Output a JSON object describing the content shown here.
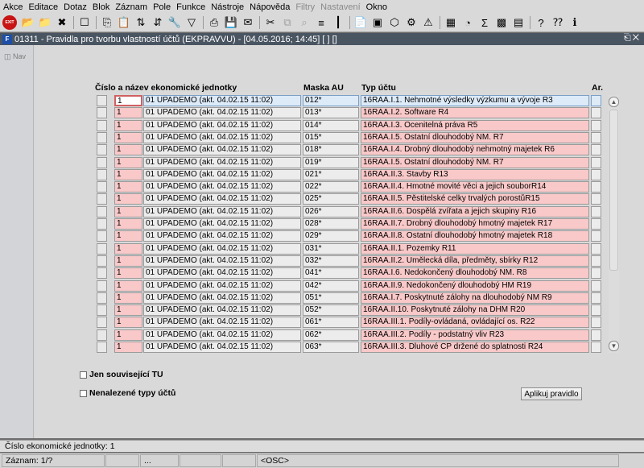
{
  "menu": [
    "Akce",
    "Editace",
    "Dotaz",
    "Blok",
    "Záznam",
    "Pole",
    "Funkce",
    "Nástroje",
    "Nápověda",
    "Filtry",
    "Nastavení",
    "Okno"
  ],
  "menu_disabled": [
    "Filtry",
    "Nastavení"
  ],
  "toolbar": {
    "exit_label": "EXIT",
    "icons": [
      "folder-add-icon",
      "folder-icon",
      "folder-delete-icon",
      "clear-icon",
      "copy-icon",
      "paste-icon",
      "sort-asc-icon",
      "sort-desc-icon",
      "wrench-icon",
      "filter-icon",
      "print-icon",
      "save-icon",
      "mail-icon",
      "cut-icon",
      "copy-block-icon",
      "find-icon",
      "indent-icon",
      "columns-icon",
      "document-icon",
      "disk-icon",
      "cube-icon",
      "tool-icon",
      "warning-icon",
      "calendar-icon",
      "chart-icon",
      "sum-icon",
      "excel-icon",
      "table-icon",
      "help-icon",
      "help-cursor-icon",
      "info-icon"
    ]
  },
  "window": {
    "title": "01311 - Pravidla pro tvorbu vlastností účtů (EKPRAVVU) - [04.05.2016; 14:45] [ ] []",
    "app_icon_label": "F",
    "controls": "⎗✕"
  },
  "nav_label": "Nav",
  "grid": {
    "headers": {
      "unit": "Číslo a název ekonomické jednotky",
      "mask": "Maska AU",
      "type": "Typ účtu",
      "ar": "Ar."
    },
    "rows": [
      {
        "code": "1",
        "name": "01 UPADEMO (akt. 04.02.15 11:02)",
        "mask": "012*",
        "typ": "16RAA.I.1.  Nehmotné výsledky výzkumu a vývoje R3"
      },
      {
        "code": "1",
        "name": "01 UPADEMO (akt. 04.02.15 11:02)",
        "mask": "013*",
        "typ": "16RAA.I.2.  Software R4"
      },
      {
        "code": "1",
        "name": "01 UPADEMO (akt. 04.02.15 11:02)",
        "mask": "014*",
        "typ": "16RAA.I.3.  Ocenitelná práva R5"
      },
      {
        "code": "1",
        "name": "01 UPADEMO (akt. 04.02.15 11:02)",
        "mask": "015*",
        "typ": "16RAA.I.5.  Ostatní dlouhodobý NM. R7"
      },
      {
        "code": "1",
        "name": "01 UPADEMO (akt. 04.02.15 11:02)",
        "mask": "018*",
        "typ": "16RAA.I.4.  Drobný dlouhodobý nehmotný majetek R6"
      },
      {
        "code": "1",
        "name": "01 UPADEMO (akt. 04.02.15 11:02)",
        "mask": "019*",
        "typ": "16RAA.I.5.  Ostatní dlouhodobý NM. R7"
      },
      {
        "code": "1",
        "name": "01 UPADEMO (akt. 04.02.15 11:02)",
        "mask": "021*",
        "typ": "16RAA.II.3.  Stavby R13"
      },
      {
        "code": "1",
        "name": "01 UPADEMO (akt. 04.02.15 11:02)",
        "mask": "022*",
        "typ": "16RAA.II.4.  Hmotné movité věci a jejich souborR14"
      },
      {
        "code": "1",
        "name": "01 UPADEMO (akt. 04.02.15 11:02)",
        "mask": "025*",
        "typ": "16RAA.II.5.  Pěstitelské celky trvalých porostůR15"
      },
      {
        "code": "1",
        "name": "01 UPADEMO (akt. 04.02.15 11:02)",
        "mask": "026*",
        "typ": "16RAA.II.6.  Dospělá zvířata a jejich skupiny R16"
      },
      {
        "code": "1",
        "name": "01 UPADEMO (akt. 04.02.15 11:02)",
        "mask": "028*",
        "typ": "16RAA.II.7.  Drobný dlouhodobý hmotný majetek R17"
      },
      {
        "code": "1",
        "name": "01 UPADEMO (akt. 04.02.15 11:02)",
        "mask": "029*",
        "typ": "16RAA.II.8.  Ostatní dlouhodobý hmotný majetek R18"
      },
      {
        "code": "1",
        "name": "01 UPADEMO (akt. 04.02.15 11:02)",
        "mask": "031*",
        "typ": "16RAA.II.1.  Pozemky R11"
      },
      {
        "code": "1",
        "name": "01 UPADEMO (akt. 04.02.15 11:02)",
        "mask": "032*",
        "typ": "16RAA.II.2.  Umělecká díla, předměty, sbírky R12"
      },
      {
        "code": "1",
        "name": "01 UPADEMO (akt. 04.02.15 11:02)",
        "mask": "041*",
        "typ": "16RAA.I.6.  Nedokončený dlouhodobý NM. R8"
      },
      {
        "code": "1",
        "name": "01 UPADEMO (akt. 04.02.15 11:02)",
        "mask": "042*",
        "typ": "16RAA.II.9.  Nedokončený dlouhodobý HM R19"
      },
      {
        "code": "1",
        "name": "01 UPADEMO (akt. 04.02.15 11:02)",
        "mask": "051*",
        "typ": "16RAA.I.7.  Poskytnuté zálohy na dlouhodobý NM R9"
      },
      {
        "code": "1",
        "name": "01 UPADEMO (akt. 04.02.15 11:02)",
        "mask": "052*",
        "typ": "16RAA.II.10.  Poskytnuté zálohy na DHM R20"
      },
      {
        "code": "1",
        "name": "01 UPADEMO (akt. 04.02.15 11:02)",
        "mask": "061*",
        "typ": "16RAA.III.1.  Podíly-ovládaná, ovládající os. R22"
      },
      {
        "code": "1",
        "name": "01 UPADEMO (akt. 04.02.15 11:02)",
        "mask": "062*",
        "typ": "16RAA.III.2.  Podíly - podstatný vliv R23"
      },
      {
        "code": "1",
        "name": "01 UPADEMO (akt. 04.02.15 11:02)",
        "mask": "063*",
        "typ": "16RAA.III.3.  Dluhové CP držené do splatnosti R24"
      }
    ]
  },
  "options": {
    "jen_souvisejici": "Jen související TU",
    "nenalezene": "Nenalezené  typy účtů"
  },
  "apply_button": "Aplikuj pravidlo",
  "status": {
    "line1": "Číslo ekonomické jednotky: 1",
    "record": "Záznam: 1/?",
    "ellipsis": "...",
    "osc": "<OSC>"
  },
  "colors": {
    "required_field": "#f9c8c8",
    "current_row": "#ddeaf8",
    "title_bar": "#4a5562"
  }
}
